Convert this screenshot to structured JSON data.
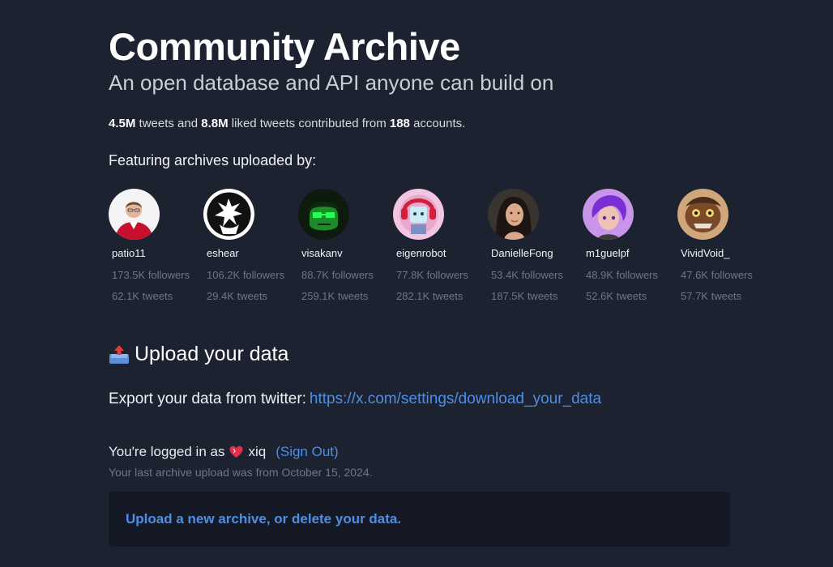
{
  "header": {
    "title": "Community Archive",
    "subtitle": "An open database and API anyone can build on"
  },
  "stats": {
    "tweets": "4.5M",
    "tweets_text": " tweets and ",
    "liked": "8.8M",
    "liked_text": " liked tweets contributed from ",
    "accounts": "188",
    "accounts_text": " accounts."
  },
  "featuring_label": "Featuring archives uploaded by:",
  "accounts": [
    {
      "handle": "patio11",
      "followers": "173.5K followers",
      "tweets": "62.1K tweets",
      "avatar_icon": "avatar-man-red-shirt"
    },
    {
      "handle": "eshear",
      "followers": "106.2K followers",
      "tweets": "29.4K tweets",
      "avatar_icon": "avatar-bw-illustration"
    },
    {
      "handle": "visakanv",
      "followers": "88.7K followers",
      "tweets": "259.1K tweets",
      "avatar_icon": "avatar-green-glasses"
    },
    {
      "handle": "eigenrobot",
      "followers": "77.8K followers",
      "tweets": "282.1K tweets",
      "avatar_icon": "avatar-pink-robot"
    },
    {
      "handle": "DanielleFong",
      "followers": "53.4K followers",
      "tweets": "187.5K tweets",
      "avatar_icon": "avatar-woman-photo"
    },
    {
      "handle": "m1guelpf",
      "followers": "48.9K followers",
      "tweets": "52.6K tweets",
      "avatar_icon": "avatar-purple-hair"
    },
    {
      "handle": "VividVoid_",
      "followers": "47.6K followers",
      "tweets": "57.7K tweets",
      "avatar_icon": "avatar-brown-creature"
    }
  ],
  "upload": {
    "heading": "Upload your data",
    "heading_icon": "outbox-tray-icon",
    "export_label": "Export your data from twitter:",
    "export_link": "https://x.com/settings/download_your_data",
    "logged_in_prefix": "You're logged in as",
    "user_icon": "heart-icon",
    "username": "xiq",
    "sign_out": "(Sign Out)",
    "last_upload": "Your last archive upload was from October 15, 2024.",
    "upload_link": "Upload a new archive, or delete your data."
  },
  "colors": {
    "background": "#1d2230",
    "panel": "#141925",
    "link": "#4c8fe6",
    "muted": "#6f7682"
  }
}
